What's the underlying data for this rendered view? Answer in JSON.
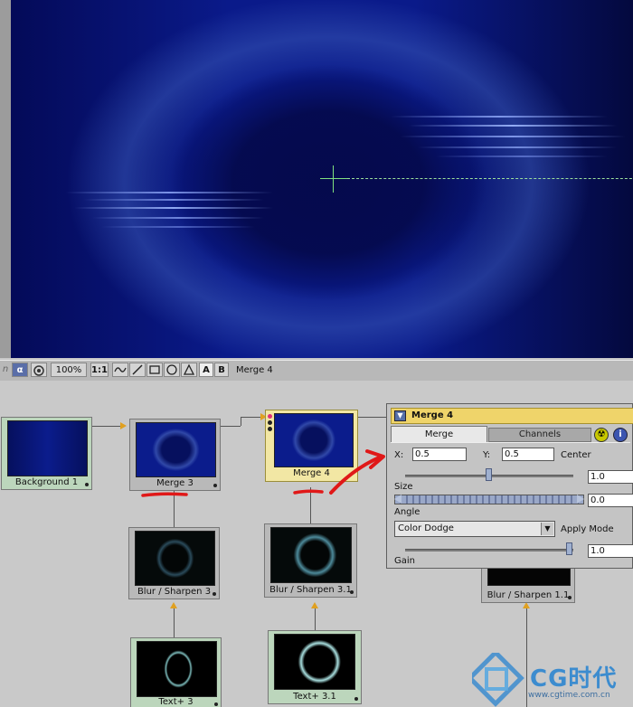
{
  "viewer": {
    "name": "viewer"
  },
  "toolbar": {
    "zoom": "100%",
    "ratio": "1:1",
    "alpha_label": "α",
    "a_label": "A",
    "b_label": "B",
    "current_node": "Merge 4"
  },
  "nodes": {
    "background": "Background 1",
    "merge3": "Merge 3",
    "merge4": "Merge 4",
    "blur3": "Blur / Sharpen 3",
    "blur31": "Blur / Sharpen 3.1",
    "blur11": "Blur / Sharpen 1.1",
    "text3": "Text+ 3",
    "text31": "Text+ 3.1"
  },
  "panel": {
    "title": "Merge 4",
    "tabs": [
      "Merge",
      "Channels"
    ],
    "x_label": "X:",
    "x_value": "0.5",
    "y_label": "Y:",
    "y_value": "0.5",
    "center_label": "Center",
    "size_value": "1.0",
    "size_label": "Size",
    "angle_value": "0.0",
    "angle_label": "Angle",
    "apply_mode_value": "Color Dodge",
    "apply_mode_label": "Apply Mode",
    "gain_value": "1.0",
    "gain_label": "Gain"
  },
  "watermark": {
    "brand": "CG时代",
    "url": "www.cgtime.com.cn"
  },
  "colors": {
    "selected_node": "#f2e7a4",
    "panel_header": "#efd46a",
    "annotation": "#e01818"
  }
}
